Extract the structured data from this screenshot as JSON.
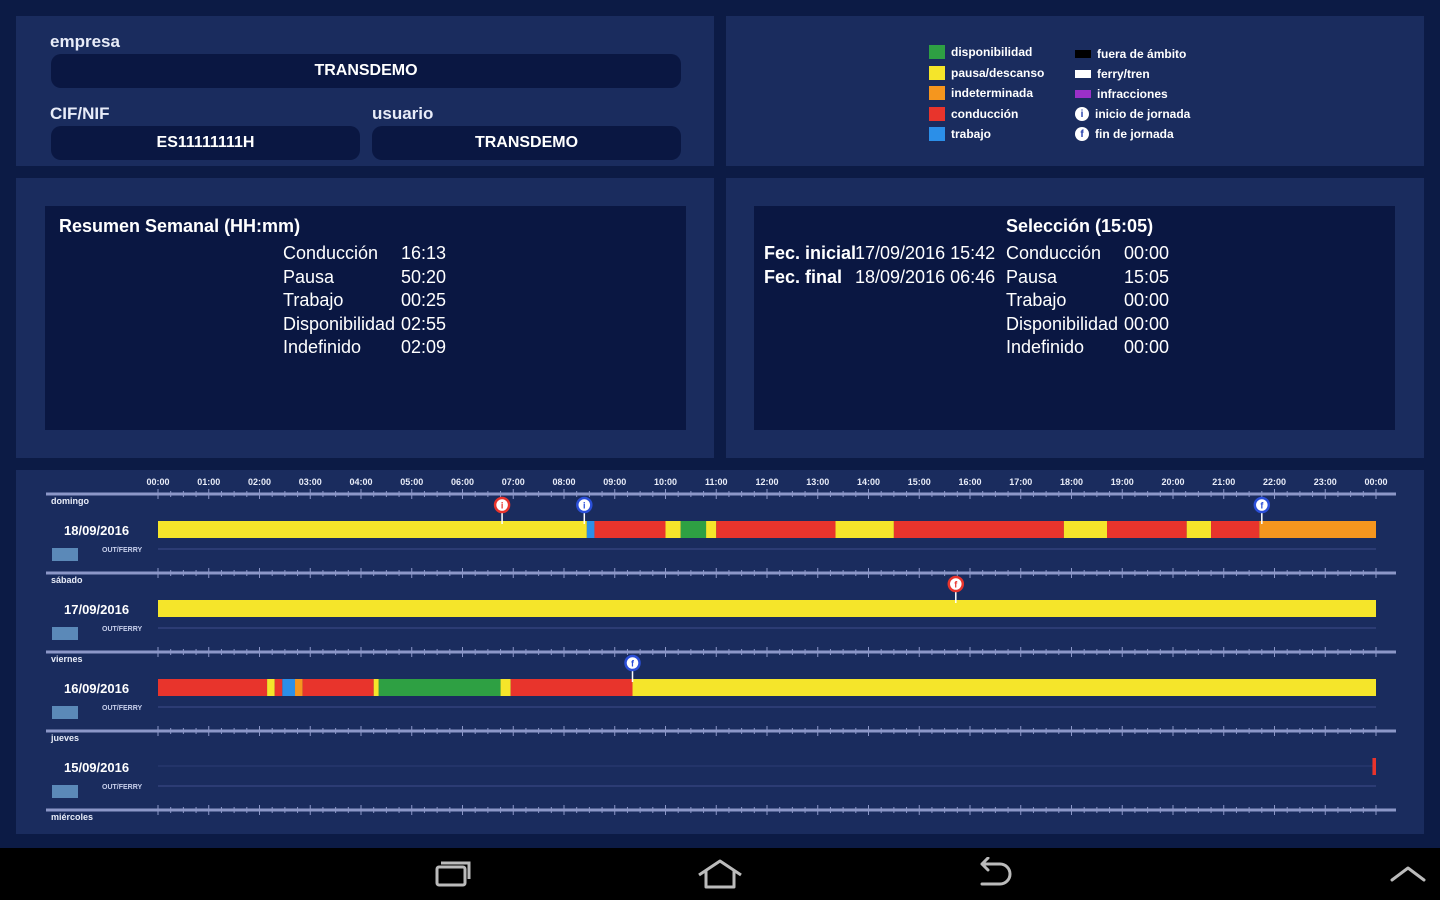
{
  "info": {
    "empresa_label": "empresa",
    "empresa_value": "TRANSDEMO",
    "cif_label": "CIF/NIF",
    "cif_value": "ES11111111H",
    "usuario_label": "usuario",
    "usuario_value": "TRANSDEMO"
  },
  "legend": {
    "left": [
      {
        "label": "disponibilidad",
        "color": "#2ea043"
      },
      {
        "label": "pausa/descanso",
        "color": "#f5e52a"
      },
      {
        "label": "indeterminada",
        "color": "#f5961e"
      },
      {
        "label": "conducción",
        "color": "#e8342c"
      },
      {
        "label": "trabajo",
        "color": "#2b8fe8"
      }
    ],
    "right": [
      {
        "label": "fuera de ámbito",
        "color": "#000000",
        "kind": "bar"
      },
      {
        "label": "ferry/tren",
        "color": "#ffffff",
        "kind": "bar"
      },
      {
        "label": "infracciones",
        "color": "#9b30c8",
        "kind": "bar"
      },
      {
        "label": "inicio de jornada",
        "icon": "i",
        "kind": "circle"
      },
      {
        "label": "fin de jornada",
        "icon": "f",
        "kind": "circle"
      }
    ]
  },
  "weekly": {
    "title": "Resumen Semanal (HH:mm)",
    "rows": [
      {
        "label": "Conducción",
        "value": "16:13"
      },
      {
        "label": "Pausa",
        "value": "50:20"
      },
      {
        "label": "Trabajo",
        "value": "00:25"
      },
      {
        "label": "Disponibilidad",
        "value": "02:55"
      },
      {
        "label": "Indefinido",
        "value": "02:09"
      }
    ]
  },
  "selection": {
    "title": "Selección (15:05)",
    "fec_inicial_label": "Fec. inicial",
    "fec_inicial_value": "17/09/2016 15:42",
    "fec_final_label": "Fec. final",
    "fec_final_value": "18/09/2016 06:46",
    "rows": [
      {
        "label": "Conducción",
        "value": "00:00"
      },
      {
        "label": "Pausa",
        "value": "15:05"
      },
      {
        "label": "Trabajo",
        "value": "00:00"
      },
      {
        "label": "Disponibilidad",
        "value": "00:00"
      },
      {
        "label": "Indefinido",
        "value": "00:00"
      }
    ]
  },
  "timeline": {
    "hours": [
      "00:00",
      "01:00",
      "02:00",
      "03:00",
      "04:00",
      "05:00",
      "06:00",
      "07:00",
      "08:00",
      "09:00",
      "10:00",
      "11:00",
      "12:00",
      "13:00",
      "14:00",
      "15:00",
      "16:00",
      "17:00",
      "18:00",
      "19:00",
      "20:00",
      "21:00",
      "22:00",
      "23:00",
      "00:00"
    ],
    "sub_label": "OUT/FERRY",
    "days": [
      {
        "weekday": "domingo",
        "date": "18/09/2016",
        "segments": [
          {
            "start": 0,
            "end": 8.45,
            "color": "#f5e52a"
          },
          {
            "start": 8.45,
            "end": 8.6,
            "color": "#2b8fe8"
          },
          {
            "start": 8.6,
            "end": 10.0,
            "color": "#e8342c"
          },
          {
            "start": 10.0,
            "end": 10.3,
            "color": "#f5e52a"
          },
          {
            "start": 10.3,
            "end": 10.8,
            "color": "#2ea043"
          },
          {
            "start": 10.8,
            "end": 11.0,
            "color": "#f5e52a"
          },
          {
            "start": 11.0,
            "end": 13.35,
            "color": "#e8342c"
          },
          {
            "start": 13.35,
            "end": 14.5,
            "color": "#f5e52a"
          },
          {
            "start": 14.5,
            "end": 17.85,
            "color": "#e8342c"
          },
          {
            "start": 17.85,
            "end": 18.7,
            "color": "#f5e52a"
          },
          {
            "start": 18.7,
            "end": 20.27,
            "color": "#e8342c"
          },
          {
            "start": 20.27,
            "end": 20.75,
            "color": "#f5e52a"
          },
          {
            "start": 20.75,
            "end": 21.7,
            "color": "#e8342c"
          },
          {
            "start": 21.7,
            "end": 24,
            "color": "#f5961e"
          }
        ],
        "markers": [
          {
            "time": 6.78,
            "type": "i",
            "color": "#e8342c"
          },
          {
            "time": 8.4,
            "type": "i",
            "color": "#2b4fd8"
          },
          {
            "time": 21.75,
            "type": "f",
            "color": "#2b4fd8"
          }
        ]
      },
      {
        "weekday": "sábado",
        "date": "17/09/2016",
        "segments": [
          {
            "start": 0,
            "end": 24,
            "color": "#f5e52a"
          }
        ],
        "markers": [
          {
            "time": 15.72,
            "type": "f",
            "color": "#e8342c"
          }
        ]
      },
      {
        "weekday": "viernes",
        "date": "16/09/2016",
        "segments": [
          {
            "start": 0,
            "end": 2.15,
            "color": "#e8342c"
          },
          {
            "start": 2.15,
            "end": 2.3,
            "color": "#f5e52a"
          },
          {
            "start": 2.3,
            "end": 2.45,
            "color": "#e8342c"
          },
          {
            "start": 2.45,
            "end": 2.7,
            "color": "#2b8fe8"
          },
          {
            "start": 2.7,
            "end": 2.85,
            "color": "#f5961e"
          },
          {
            "start": 2.85,
            "end": 4.25,
            "color": "#e8342c"
          },
          {
            "start": 4.25,
            "end": 4.35,
            "color": "#f5e52a"
          },
          {
            "start": 4.35,
            "end": 6.75,
            "color": "#2ea043"
          },
          {
            "start": 6.75,
            "end": 6.95,
            "color": "#f5e52a"
          },
          {
            "start": 6.95,
            "end": 9.35,
            "color": "#e8342c"
          },
          {
            "start": 9.35,
            "end": 24,
            "color": "#f5e52a"
          }
        ],
        "markers": [
          {
            "time": 9.35,
            "type": "f",
            "color": "#2b4fd8"
          }
        ]
      },
      {
        "weekday": "jueves",
        "date": "15/09/2016",
        "segments": [
          {
            "start": 23.93,
            "end": 24,
            "color": "#e8342c"
          }
        ],
        "markers": []
      }
    ],
    "trailing_weekday": "miércoles"
  }
}
